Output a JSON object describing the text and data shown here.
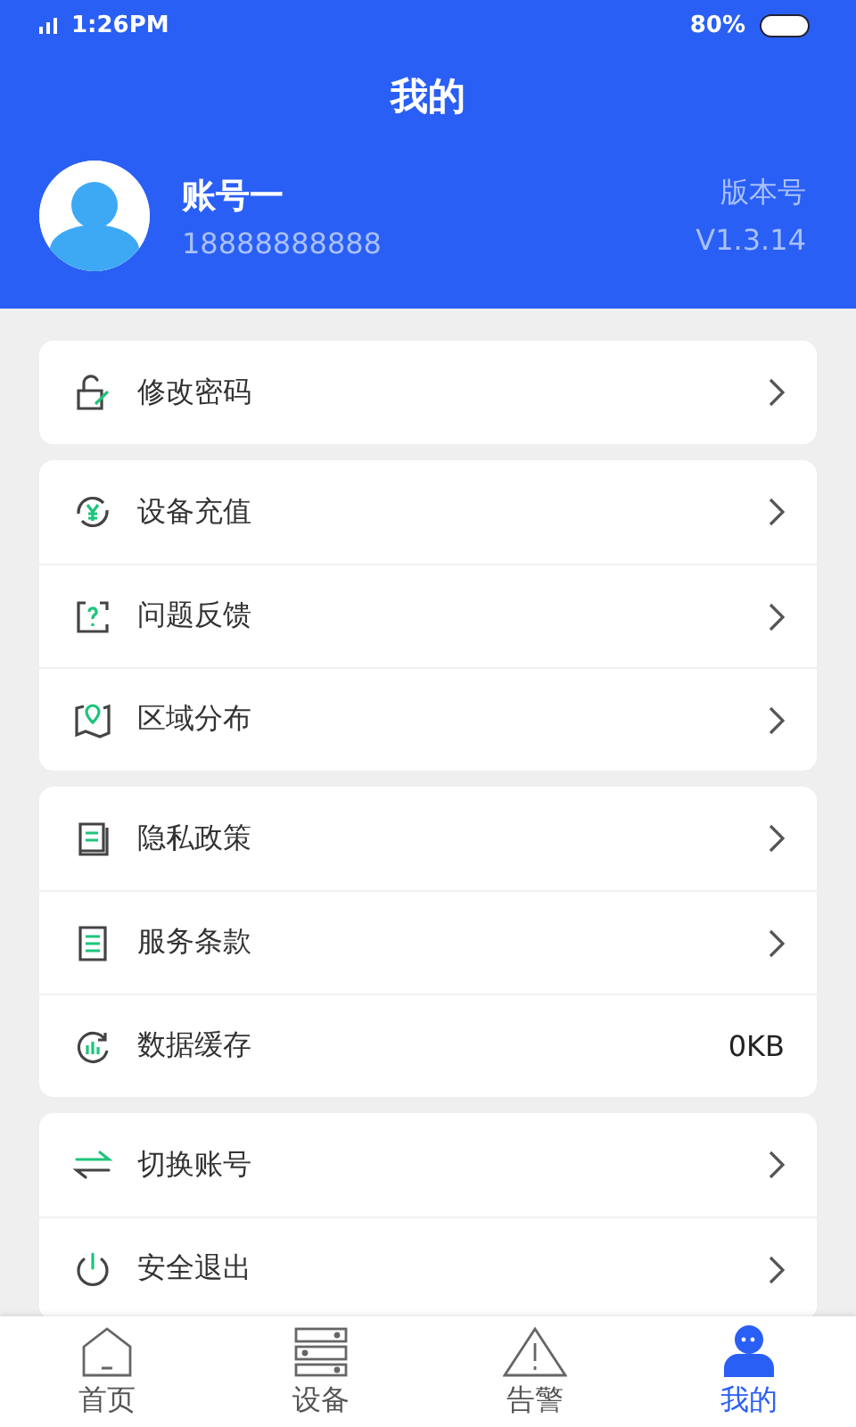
{
  "status_bar": {
    "time": "1:26PM",
    "battery": "80%"
  },
  "header": {
    "title": "我的"
  },
  "profile": {
    "name": "账号一",
    "phone": "18888888888",
    "version_label": "版本号",
    "version": "V1.3.14"
  },
  "groups": [
    {
      "items": [
        {
          "label": "修改密码",
          "kind": "link"
        }
      ]
    },
    {
      "items": [
        {
          "label": "设备充值",
          "kind": "link"
        },
        {
          "label": "问题反馈",
          "kind": "link"
        },
        {
          "label": "区域分布",
          "kind": "link"
        }
      ]
    },
    {
      "items": [
        {
          "label": "隐私政策",
          "kind": "link"
        },
        {
          "label": "服务条款",
          "kind": "link"
        },
        {
          "label": "数据缓存",
          "kind": "value",
          "value": "0KB"
        }
      ]
    },
    {
      "items": [
        {
          "label": "切换账号",
          "kind": "link"
        },
        {
          "label": "安全退出",
          "kind": "link"
        }
      ]
    }
  ],
  "tabs": [
    {
      "label": "首页",
      "selected": false
    },
    {
      "label": "设备",
      "selected": false
    },
    {
      "label": "告警",
      "selected": false
    },
    {
      "label": "我的",
      "selected": true
    }
  ]
}
